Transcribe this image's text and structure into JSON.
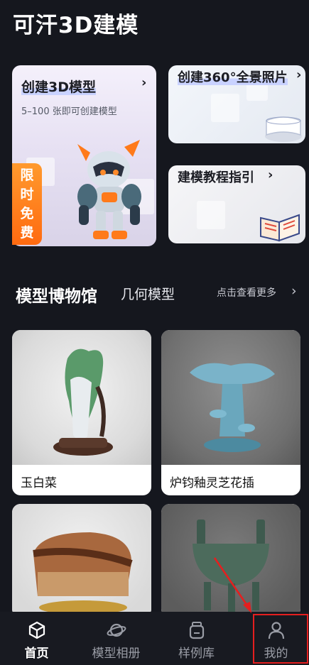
{
  "app": {
    "title": "可汗3D建模"
  },
  "features": {
    "main": {
      "title": "创建3D模型",
      "arrow": "›",
      "subtitle": "5–100 张即可创建模型",
      "badge": [
        "限",
        "时",
        "免",
        "费"
      ]
    },
    "panorama": {
      "title": "创建360°全景照片",
      "arrow": "›"
    },
    "tutorial": {
      "title": "建模教程指引",
      "arrow": "›"
    }
  },
  "museum": {
    "title": "模型博物馆",
    "tab": "几何模型",
    "more": "点击查看更多",
    "more_arrow": "›",
    "items": [
      {
        "label": "玉白菜"
      },
      {
        "label": "炉钧釉灵芝花插"
      },
      {
        "label": ""
      },
      {
        "label": ""
      }
    ]
  },
  "nav": {
    "items": [
      {
        "label": "首页",
        "icon": "cube-icon",
        "active": true
      },
      {
        "label": "模型相册",
        "icon": "planet-icon",
        "active": false
      },
      {
        "label": "样例库",
        "icon": "jar-icon",
        "active": false
      },
      {
        "label": "我的",
        "icon": "user-icon",
        "active": false
      }
    ]
  },
  "colors": {
    "background": "#15171e",
    "badge": "#ff7a1a",
    "highlight": "#e51f1f"
  }
}
